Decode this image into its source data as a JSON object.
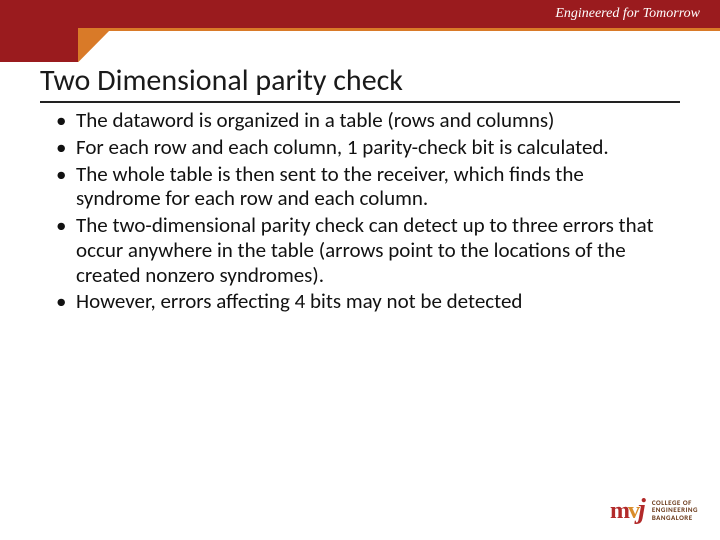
{
  "header": {
    "tagline": "Engineered for Tomorrow"
  },
  "title": "Two Dimensional parity check",
  "bullets": [
    "The dataword is organized in a table (rows and columns)",
    "For each row and each column, 1 parity-check bit is calculated.",
    "The whole table is then sent to the receiver, which finds the syndrome for each row and each column.",
    "The two-dimensional parity check can detect up to three errors that occur anywhere in the table (arrows point to the locations of the created nonzero syndromes).",
    "However, errors affecting 4 bits may not be detected"
  ],
  "logo": {
    "m": "m",
    "v": "v",
    "j": "j",
    "line1": "COLLEGE OF",
    "line2": "ENGINEERING",
    "line3": "BANGALORE"
  }
}
